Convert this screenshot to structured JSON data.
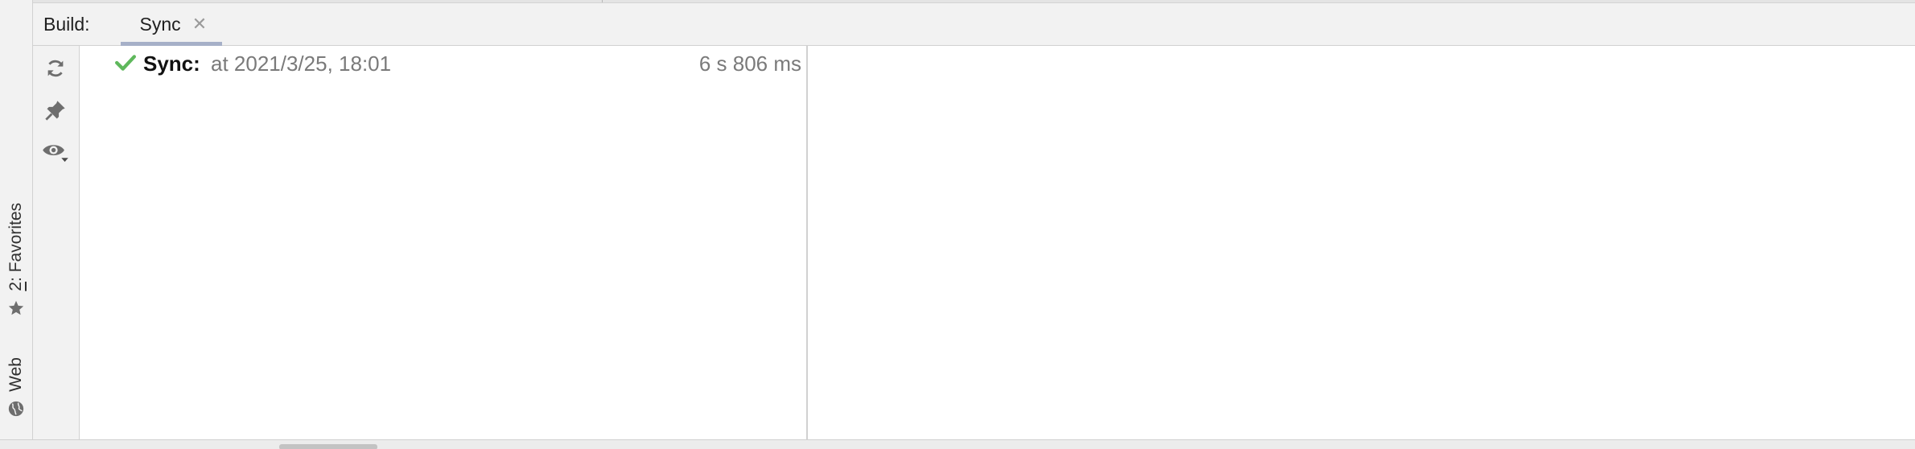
{
  "left_strip": {
    "favorites_label_prefix": "2",
    "favorites_label_suffix": ": Favorites",
    "web_label": "Web"
  },
  "header": {
    "build_label": "Build:",
    "tabs": [
      {
        "label": "Sync",
        "active": true,
        "closable": true
      }
    ]
  },
  "toolbar": {
    "buttons": [
      "refresh-icon",
      "pin-icon",
      "eye-icon"
    ]
  },
  "tree": {
    "rows": [
      {
        "status": "success",
        "title": "Sync:",
        "detail": "at 2021/3/25, 18:01",
        "duration": "6 s 806 ms"
      }
    ]
  },
  "colors": {
    "success": "#5fb85c",
    "icon_gray": "#6e6e6e",
    "tab_underline": "#a6b0c8"
  }
}
